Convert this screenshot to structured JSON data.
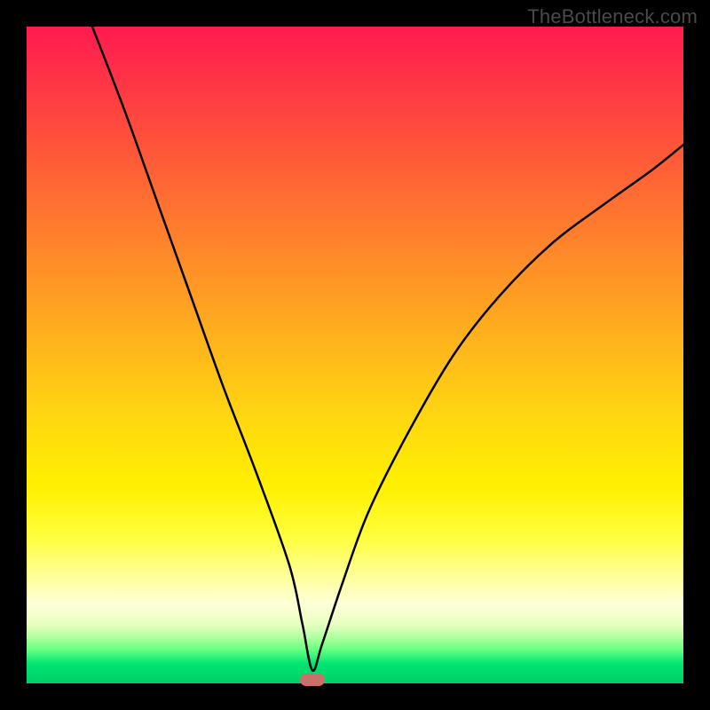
{
  "watermark": "TheBottleneck.com",
  "chart_data": {
    "type": "line",
    "title": "",
    "xlabel": "",
    "ylabel": "",
    "xlim": [
      0,
      100
    ],
    "ylim": [
      0,
      100
    ],
    "grid": false,
    "series": [
      {
        "name": "bottleneck-curve",
        "x": [
          10,
          15,
          20,
          25,
          30,
          35,
          40,
          42,
          43.5,
          45,
          48,
          52,
          58,
          65,
          72,
          80,
          88,
          95,
          100
        ],
        "y": [
          100,
          87,
          73,
          59,
          45,
          32,
          18,
          9,
          2,
          6,
          15,
          26,
          38,
          50,
          59,
          67,
          73,
          78,
          82
        ]
      }
    ],
    "annotations": [
      {
        "name": "minimum-marker",
        "x": 43.5,
        "y": 0.5,
        "color": "#cc6f6a"
      }
    ],
    "background_gradient": {
      "top": "#ff1a4f",
      "middle": "#fff000",
      "bottom": "#00d066"
    }
  }
}
